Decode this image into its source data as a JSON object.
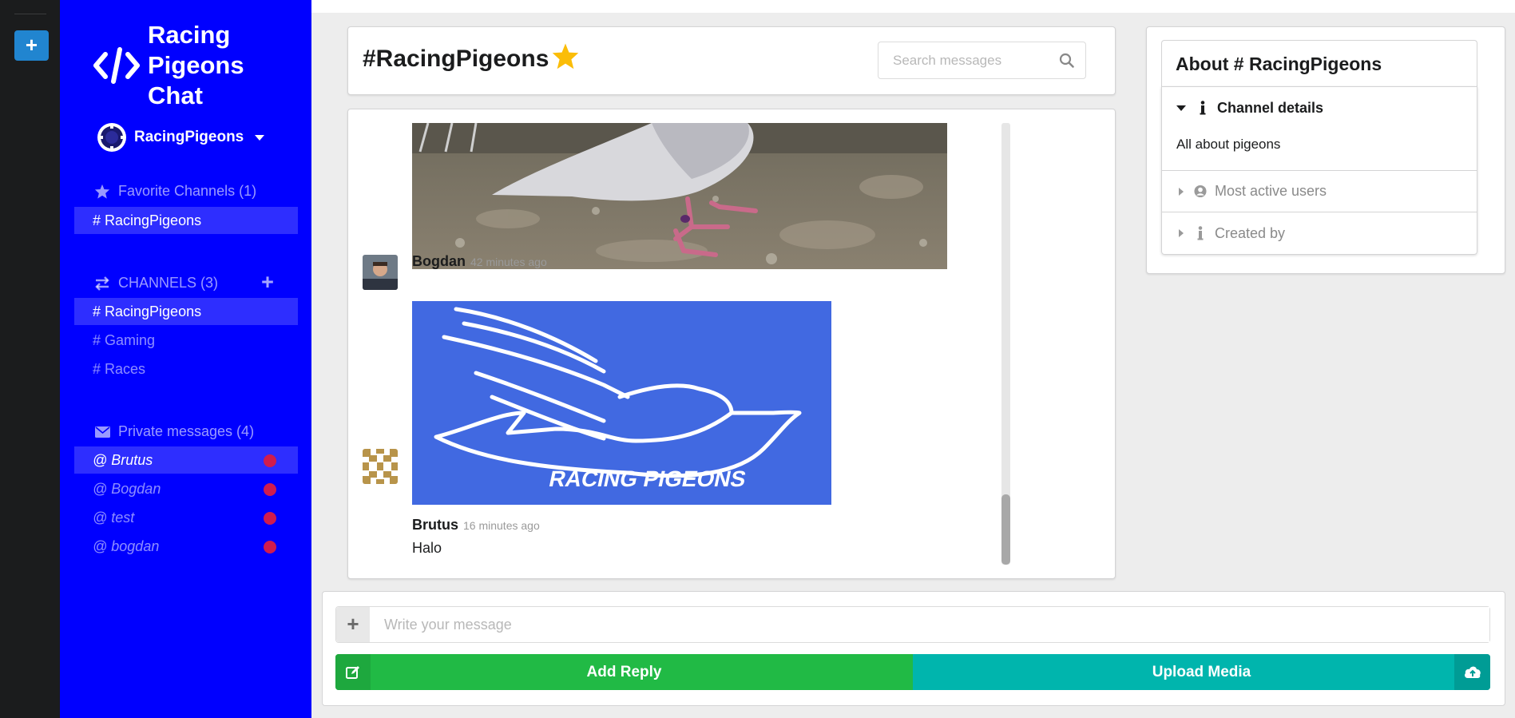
{
  "app": {
    "title": "Racing Pigeons Chat",
    "brand_icon": "code-icon"
  },
  "rail": {
    "add_label": "+"
  },
  "workspace": {
    "name": "RacingPigeons"
  },
  "sidebar": {
    "favorites": {
      "label": "Favorite Channels (1)",
      "icon": "star-icon",
      "items": [
        "# RacingPigeons"
      ]
    },
    "channels": {
      "label": "CHANNELS (3)",
      "icon": "exchange-icon",
      "add_label": "+",
      "items": [
        "# RacingPigeons",
        "# Gaming",
        "# Races"
      ]
    },
    "private": {
      "label": "Private messages (4)",
      "icon": "mail-icon",
      "items": [
        "@ Brutus",
        "@ Bogdan",
        "@ test",
        "@ bogdan"
      ]
    }
  },
  "channel": {
    "title": "#RacingPigeons",
    "search_placeholder": "Search messages"
  },
  "messages": [
    {
      "author": "Bogdan",
      "time": "42 minutes ago",
      "image_text": "RACING   PIGEONS"
    },
    {
      "author": "Brutus",
      "time": "16 minutes ago",
      "text": "Halo"
    }
  ],
  "about": {
    "title": "About # RacingPigeons",
    "sections": [
      {
        "label": "Channel details",
        "body": "All about pigeons"
      },
      {
        "label": "Most active users"
      },
      {
        "label": "Created by"
      }
    ]
  },
  "composer": {
    "placeholder": "Write your message",
    "add_label": "+",
    "reply_label": "Add Reply",
    "upload_label": "Upload Media"
  },
  "colors": {
    "sidebar": "#0000ff",
    "reply": "#21ba45",
    "upload": "#00b5ad",
    "unread_dot": "#d01c4e",
    "logo_bg": "#4169e1"
  }
}
